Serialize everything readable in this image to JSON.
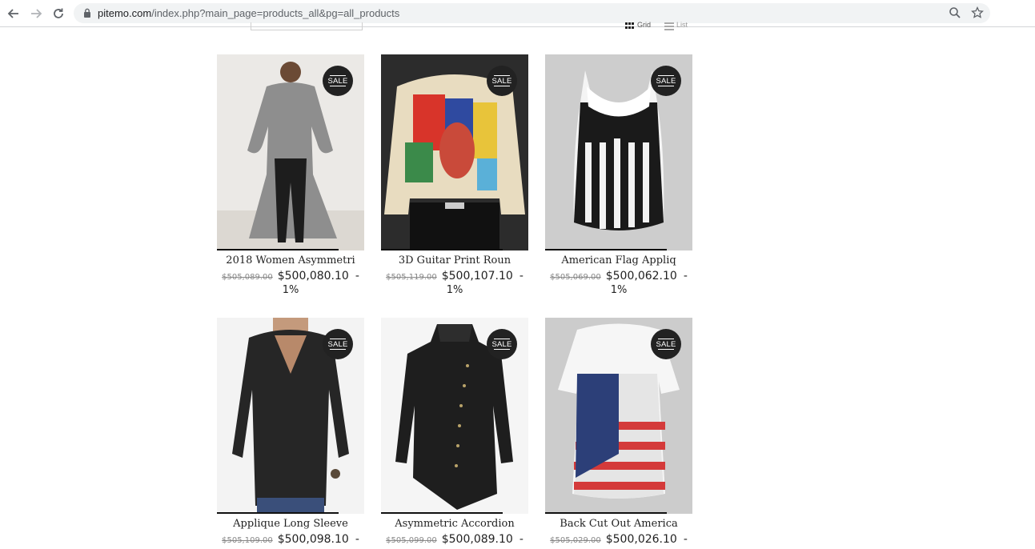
{
  "browser": {
    "url_host": "pitemo.com",
    "url_path": "/index.php?main_page=products_all&pg=all_products"
  },
  "view": {
    "grid_label": "Grid",
    "list_label": "List"
  },
  "sale_badge": "SALE",
  "products": [
    {
      "name": "2018 Women Asymmetri",
      "old_price": "$505,089.00",
      "price": "$500,080.10",
      "dash": "-",
      "discount": "1%"
    },
    {
      "name": "3D Guitar Print Roun",
      "old_price": "$505,119.00",
      "price": "$500,107.10",
      "dash": "-",
      "discount": "1%"
    },
    {
      "name": "American Flag Appliq",
      "old_price": "$505,069.00",
      "price": "$500,062.10",
      "dash": "-",
      "discount": "1%"
    },
    {
      "name": "Applique Long Sleeve",
      "old_price": "$505,109.00",
      "price": "$500,098.10",
      "dash": "-"
    },
    {
      "name": "Asymmetric Accordion",
      "old_price": "$505,099.00",
      "price": "$500,089.10",
      "dash": "-"
    },
    {
      "name": "Back Cut Out America",
      "old_price": "$505,029.00",
      "price": "$500,026.10",
      "dash": "-"
    }
  ],
  "icons": {
    "back": "arrow-left-icon",
    "forward": "arrow-right-icon",
    "reload": "reload-icon",
    "lock": "lock-icon",
    "zoom": "zoom-icon",
    "bookmark": "star-icon"
  }
}
